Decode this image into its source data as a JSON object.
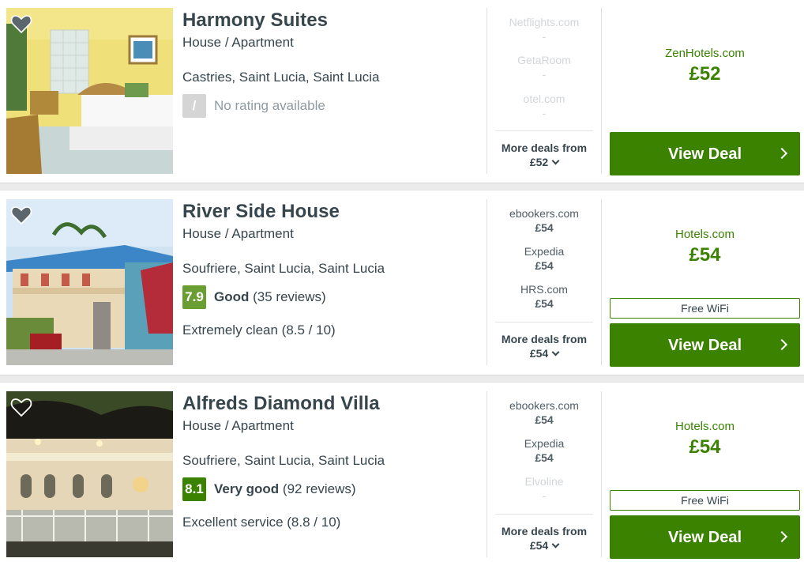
{
  "hotels": [
    {
      "name": "Harmony Suites",
      "type": "House / Apartment",
      "location": "Castries, Saint Lucia, Saint Lucia",
      "score": "/",
      "rating_label": "",
      "rating_text": "No rating available",
      "highlight": "",
      "deals": [
        {
          "site": "Netflights.com",
          "price": "-"
        },
        {
          "site": "GetaRoom",
          "price": "-"
        },
        {
          "site": "otel.com",
          "price": "-"
        }
      ],
      "more_deals_label": "More deals from",
      "more_deals_price": "£52",
      "best_provider": "ZenHotels.com",
      "best_price": "£52",
      "wifi": "",
      "view_deal": "View Deal"
    },
    {
      "name": "River Side House",
      "type": "House / Apartment",
      "location": "Soufriere, Saint Lucia, Saint Lucia",
      "score": "7.9",
      "rating_label": "Good",
      "rating_text": "(35 reviews)",
      "highlight": "Extremely clean (8.5 / 10)",
      "deals": [
        {
          "site": "ebookers.com",
          "price": "£54"
        },
        {
          "site": "Expedia",
          "price": "£54"
        },
        {
          "site": "HRS.com",
          "price": "£54"
        }
      ],
      "more_deals_label": "More deals from",
      "more_deals_price": "£54",
      "best_provider": "Hotels.com",
      "best_price": "£54",
      "wifi": "Free WiFi",
      "view_deal": "View Deal"
    },
    {
      "name": "Alfreds Diamond Villa",
      "type": "House / Apartment",
      "location": "Soufriere, Saint Lucia, Saint Lucia",
      "score": "8.1",
      "rating_label": "Very good",
      "rating_text": "(92 reviews)",
      "highlight": "Excellent service (8.8 / 10)",
      "deals": [
        {
          "site": "ebookers.com",
          "price": "£54"
        },
        {
          "site": "Expedia",
          "price": "£54"
        },
        {
          "site": "Elvoline",
          "price": "-"
        }
      ],
      "more_deals_label": "More deals from",
      "more_deals_price": "£54",
      "best_provider": "Hotels.com",
      "best_price": "£54",
      "wifi": "Free WiFi",
      "view_deal": "View Deal"
    }
  ],
  "colors": {
    "accent_green": "#3a8200",
    "good_score": "#6a9d32",
    "no_score": "#d5d5d5",
    "text": "#37454d"
  },
  "icons": {
    "favourite": "heart-icon",
    "more": "chevron-down-icon",
    "view": "chevron-right-icon"
  }
}
